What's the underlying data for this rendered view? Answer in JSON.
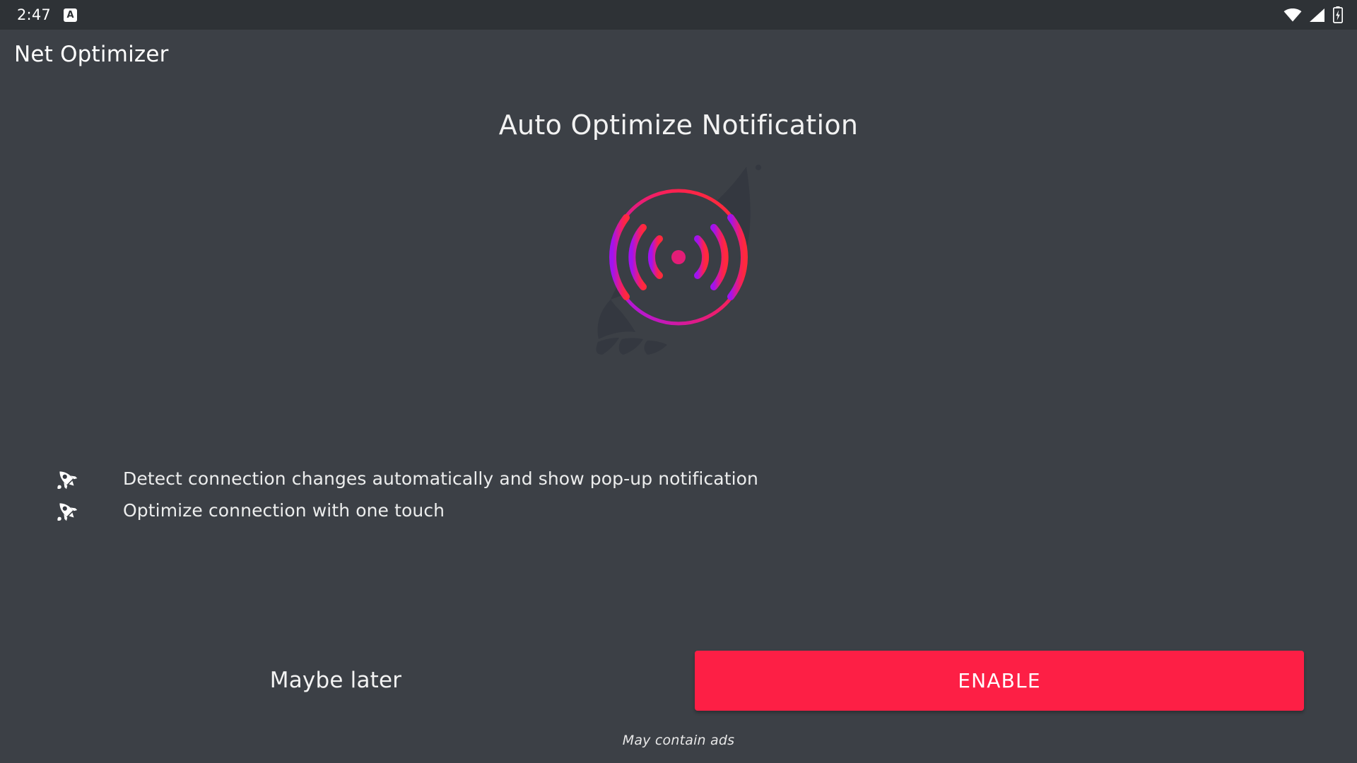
{
  "status_bar": {
    "clock": "2:47",
    "notification_badge_letter": "A",
    "icons": [
      "wifi-icon",
      "cell-signal-icon",
      "battery-charging-icon"
    ]
  },
  "app_bar": {
    "title": "Net Optimizer"
  },
  "main": {
    "headline": "Auto Optimize Notification",
    "hero_icon": "rocket-signal-logo",
    "features": [
      {
        "icon": "rocket-icon",
        "text": "Detect connection changes automatically and show pop-up notification"
      },
      {
        "icon": "rocket-icon",
        "text": "Optimize connection with one touch"
      }
    ]
  },
  "actions": {
    "secondary_label": "Maybe later",
    "primary_label": "ENABLE"
  },
  "footnote": "May contain ads",
  "colors": {
    "background": "#3c4046",
    "status_bar": "#2e3236",
    "primary_accent": "#fd1f45",
    "logo_gradient_start": "#a020f0",
    "logo_gradient_end": "#ff2040",
    "rocket_silhouette": "#343840",
    "text_primary": "#ffffff"
  }
}
